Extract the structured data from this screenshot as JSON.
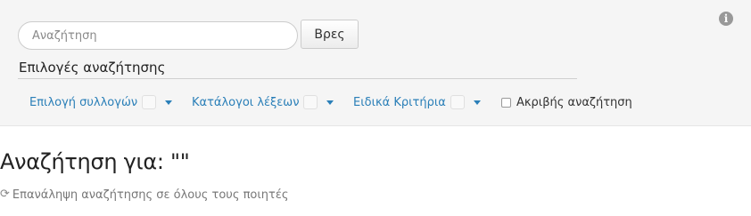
{
  "search": {
    "placeholder": "Αναζήτηση",
    "value": "",
    "button_label": "Βρες"
  },
  "options": {
    "title": "Επιλογές αναζήτησης",
    "filters": [
      {
        "label": "Επιλογή συλλογών",
        "icon": "chevron-down-icon"
      },
      {
        "label": "Κατάλογοι λέξεων",
        "icon": "chevron-down-icon"
      },
      {
        "label": "Ειδικά Κριτήρια",
        "icon": "chevron-down-icon"
      }
    ],
    "exact_search": {
      "label": "Ακριβής αναζήτηση",
      "checked": false
    }
  },
  "info": {
    "icon": "info-icon",
    "glyph": "i"
  },
  "results": {
    "title": "Αναζήτηση για: \"\"",
    "repeat_label": "Επανάληψη αναζήτησης σε όλους τους ποιητές",
    "repeat_icon": "refresh-icon",
    "repeat_glyph": "⟳"
  },
  "colors": {
    "panel_bg": "#f5f5f5",
    "link": "#2a7fb8",
    "muted": "#777777"
  }
}
